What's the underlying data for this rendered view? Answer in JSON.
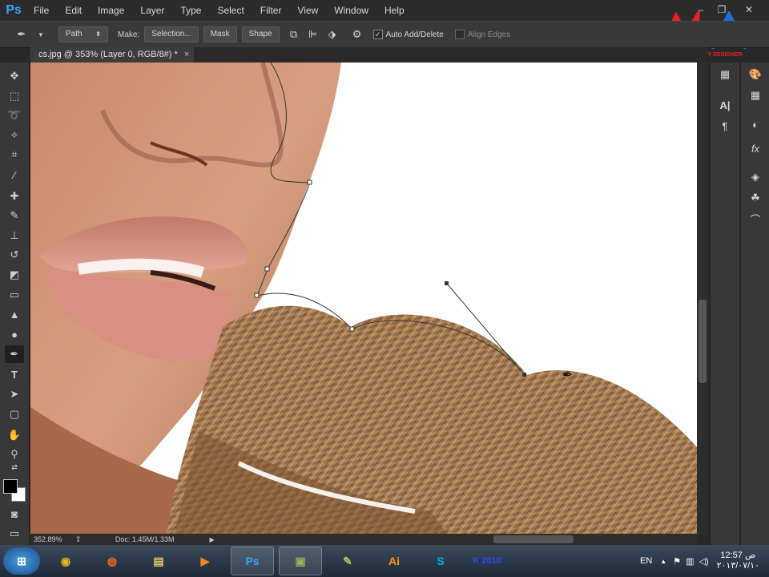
{
  "app": {
    "logo": "Ps"
  },
  "menu": [
    "File",
    "Edit",
    "Image",
    "Layer",
    "Type",
    "Select",
    "Filter",
    "View",
    "Window",
    "Help"
  ],
  "window_controls": {
    "minimize": "–",
    "restore": "❐",
    "close": "✕"
  },
  "watermark": {
    "line1": "MA",
    "line2": "© MAHMOUD AFIFY DESIGNER"
  },
  "options": {
    "mode_value": "Path",
    "make_label": "Make:",
    "selection_btn": "Selection...",
    "mask_btn": "Mask",
    "shape_btn": "Shape",
    "auto_add_delete": "Auto Add/Delete",
    "align_edges": "Align Edges"
  },
  "document": {
    "tab_title": "cs.jpg @ 353% (Layer 0, RGB/8#) *",
    "close": "×"
  },
  "status": {
    "zoom": "352.89%",
    "doc_info": "Doc: 1.45M/1.33M"
  },
  "taskbar": {
    "language": "EN",
    "time": "12:57 ص",
    "date": "٢٠١٣/٠٧/١٠",
    "apps": [
      {
        "name": "start",
        "label": "⊞"
      },
      {
        "name": "chrome",
        "label": "◉"
      },
      {
        "name": "firefox",
        "label": "◍"
      },
      {
        "name": "explorer",
        "label": "▤"
      },
      {
        "name": "media-player",
        "label": "▶"
      },
      {
        "name": "photoshop",
        "label": "Ps"
      },
      {
        "name": "camtasia",
        "label": "▣"
      },
      {
        "name": "notepad",
        "label": "✎"
      },
      {
        "name": "illustrator",
        "label": "Ai"
      },
      {
        "name": "skype",
        "label": "S"
      },
      {
        "name": "kaspersky",
        "label": "K 2010"
      }
    ]
  }
}
